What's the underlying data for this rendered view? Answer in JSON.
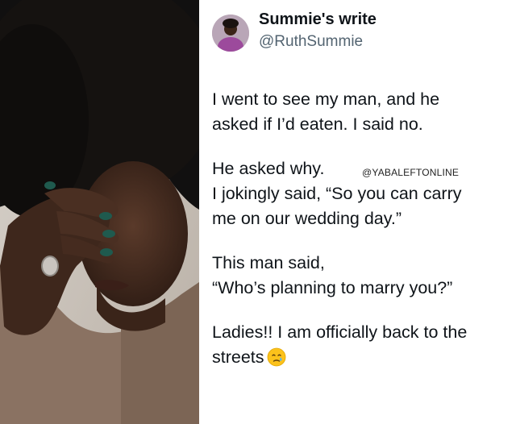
{
  "tweet": {
    "display_name": "Summie's write",
    "handle": "@RuthSummie",
    "paragraphs": [
      [
        "I went to see my man, and he",
        "asked if I’d eaten. I said no."
      ],
      [
        "He asked why.",
        "I jokingly said, “So you can carry",
        "me on our wedding day.”"
      ],
      [
        "This man said,",
        "“Who’s planning to marry you?”"
      ],
      [
        "Ladies!! I am officially back to the",
        "streets"
      ]
    ],
    "emoji": "crying-face-emoji"
  },
  "watermark": "@YABALEFTONLINE",
  "colors": {
    "text": "#0f1419",
    "handle": "#536471",
    "background": "#ffffff"
  }
}
